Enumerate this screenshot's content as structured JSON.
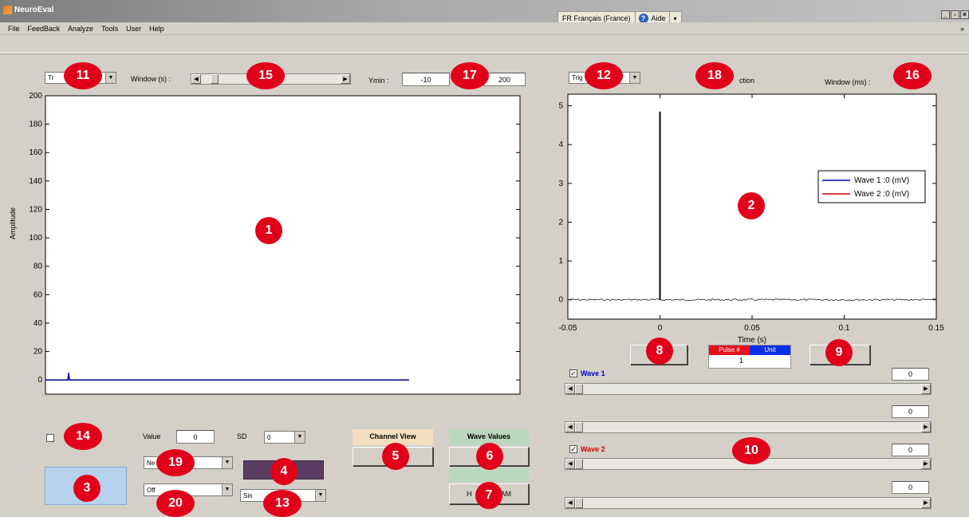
{
  "window": {
    "title": "NeuroEval",
    "language": "FR Français (France)",
    "help": "Aide",
    "controls": [
      "_",
      "▫",
      "×"
    ]
  },
  "menu": [
    "File",
    "FeedBack",
    "Analyze",
    "Tools",
    "User",
    "Help"
  ],
  "left_panel": {
    "trigger_select": "Tr",
    "window_label": "Window (s) :",
    "ymin_label": "Ymin :",
    "ymin_value": "-10",
    "ymax_value": "200",
    "chart_ylabel": "Amplitude"
  },
  "right_panel": {
    "trigger_select": "Trig",
    "section_label": "ction",
    "window_label": "Window (ms) :",
    "xlabel": "Time (s)",
    "legend": [
      "Wave 1 :0 (mV)",
      "Wave 2 :0 (mV)"
    ]
  },
  "pulse_table": {
    "headers": [
      "Pulse #",
      "Unit"
    ],
    "value": "1",
    "left_button": "P"
  },
  "waves": {
    "wave1": {
      "label": "Wave 1",
      "checked": true,
      "value": "0",
      "color": "#0000cc"
    },
    "row2_value": "0",
    "wave2": {
      "label": "Wave 2",
      "checked": true,
      "value": "0",
      "color": "#cc0000"
    },
    "row4_value": "0"
  },
  "bottom": {
    "value_label": "Value",
    "value_value": "0",
    "sd_label": "SD",
    "sd_value": "0",
    "select_19": "Ne",
    "select_20": "Off",
    "select_13": "Sin",
    "channel_view_label": "Channel View",
    "channel_view_button": "P",
    "wave_values_label": "Wave Values",
    "button_7": "H",
    "button_7_suffix": "AM"
  },
  "markers": [
    "1",
    "2",
    "3",
    "4",
    "5",
    "6",
    "7",
    "8",
    "9",
    "10",
    "11",
    "12",
    "13",
    "14",
    "15",
    "16",
    "17",
    "18",
    "19",
    "20"
  ],
  "chart_data": [
    {
      "type": "line",
      "ylabel": "Amplitude",
      "ylim": [
        -10,
        200
      ],
      "yticks": [
        0,
        20,
        40,
        60,
        80,
        100,
        120,
        140,
        160,
        180,
        200
      ],
      "series": [
        {
          "values": [
            0,
            0,
            5,
            0,
            0
          ],
          "color": "#00008b"
        }
      ]
    },
    {
      "type": "line",
      "xlabel": "Time (s)",
      "xlim": [
        -0.05,
        0.15
      ],
      "ylim": [
        -0.5,
        5.3
      ],
      "xticks": [
        -0.05,
        0,
        0.05,
        0.1,
        0.15
      ],
      "yticks": [
        0,
        1,
        2,
        3,
        4,
        5
      ],
      "legend": [
        "Wave 1 :0 (mV)",
        "Wave 2 :0 (mV)"
      ],
      "legend_position": "right",
      "series": [
        {
          "name": "Wave 1 :0 (mV)",
          "color": "#0000cc"
        },
        {
          "name": "Wave 2 :0 (mV)",
          "color": "#cc0000"
        }
      ],
      "stimulus": {
        "x": 0,
        "y": 4.85
      }
    }
  ]
}
